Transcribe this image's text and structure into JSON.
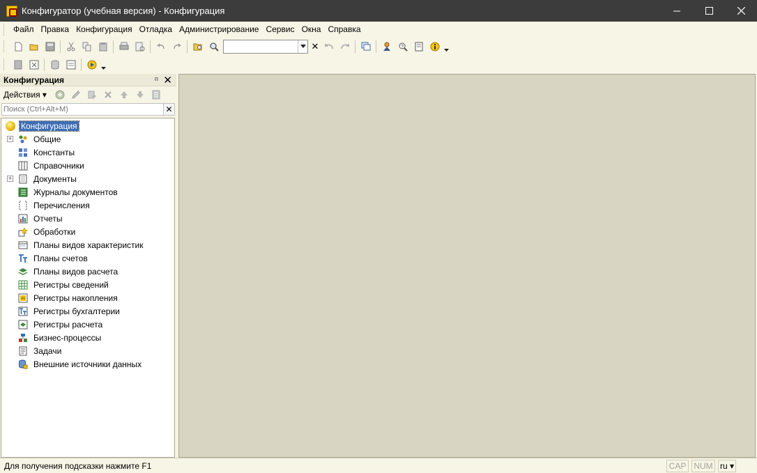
{
  "window": {
    "title": "Конфигуратор (учебная версия) - Конфигурация",
    "minimize": "–",
    "maximize": "☐",
    "close": "✕"
  },
  "menu": [
    {
      "label": "Файл"
    },
    {
      "label": "Правка"
    },
    {
      "label": "Конфигурация"
    },
    {
      "label": "Отладка"
    },
    {
      "label": "Администрирование"
    },
    {
      "label": "Сервис"
    },
    {
      "label": "Окна"
    },
    {
      "label": "Справка"
    }
  ],
  "toolbar": {
    "search_value": "",
    "search_clear": "✕"
  },
  "panel": {
    "title": "Конфигурация",
    "pin": "ᴨ",
    "close": "✕",
    "actions_label": "Действия",
    "actions_arrow": "▾",
    "filter_placeholder": "Поиск (Ctrl+Alt+M)",
    "filter_clear": "✕"
  },
  "tree": {
    "root": "Конфигурация",
    "items": [
      {
        "label": "Общие",
        "expandable": true,
        "icon": "common-icon"
      },
      {
        "label": "Константы",
        "expandable": false,
        "icon": "constants-icon"
      },
      {
        "label": "Справочники",
        "expandable": false,
        "icon": "catalogs-icon"
      },
      {
        "label": "Документы",
        "expandable": true,
        "icon": "documents-icon"
      },
      {
        "label": "Журналы документов",
        "expandable": false,
        "icon": "document-journals-icon"
      },
      {
        "label": "Перечисления",
        "expandable": false,
        "icon": "enumerations-icon"
      },
      {
        "label": "Отчеты",
        "expandable": false,
        "icon": "reports-icon"
      },
      {
        "label": "Обработки",
        "expandable": false,
        "icon": "data-processors-icon"
      },
      {
        "label": "Планы видов характеристик",
        "expandable": false,
        "icon": "characteristic-types-icon"
      },
      {
        "label": "Планы счетов",
        "expandable": false,
        "icon": "charts-of-accounts-icon"
      },
      {
        "label": "Планы видов расчета",
        "expandable": false,
        "icon": "calculation-types-icon"
      },
      {
        "label": "Регистры сведений",
        "expandable": false,
        "icon": "information-registers-icon"
      },
      {
        "label": "Регистры накопления",
        "expandable": false,
        "icon": "accumulation-registers-icon"
      },
      {
        "label": "Регистры бухгалтерии",
        "expandable": false,
        "icon": "accounting-registers-icon"
      },
      {
        "label": "Регистры расчета",
        "expandable": false,
        "icon": "calculation-registers-icon"
      },
      {
        "label": "Бизнес-процессы",
        "expandable": false,
        "icon": "business-processes-icon"
      },
      {
        "label": "Задачи",
        "expandable": false,
        "icon": "tasks-icon"
      },
      {
        "label": "Внешние источники данных",
        "expandable": false,
        "icon": "external-data-sources-icon"
      }
    ]
  },
  "status": {
    "hint": "Для получения подсказки нажмите F1",
    "cap": "CAP",
    "num": "NUM",
    "lang": "ru ▾"
  }
}
